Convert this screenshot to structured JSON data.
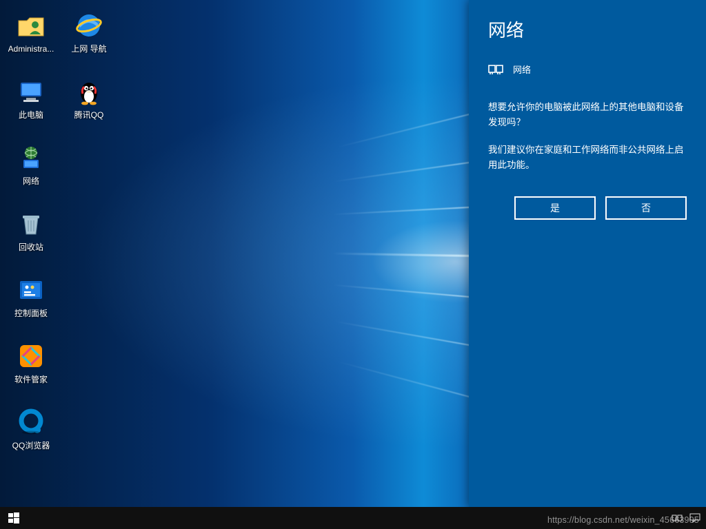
{
  "desktop": {
    "icons": [
      {
        "id": "user-folder",
        "label": "Administra...",
        "kind": "user-folder"
      },
      {
        "id": "ie",
        "label": "上网 导航",
        "kind": "ie"
      },
      {
        "id": "this-pc",
        "label": "此电脑",
        "kind": "pc"
      },
      {
        "id": "qq",
        "label": "腾讯QQ",
        "kind": "qq"
      },
      {
        "id": "network",
        "label": "网络",
        "kind": "network"
      },
      {
        "id": "blank1",
        "label": "",
        "kind": "none"
      },
      {
        "id": "recycle-bin",
        "label": "回收站",
        "kind": "recycle"
      },
      {
        "id": "blank2",
        "label": "",
        "kind": "none"
      },
      {
        "id": "control-panel",
        "label": "控制面板",
        "kind": "control"
      },
      {
        "id": "blank3",
        "label": "",
        "kind": "none"
      },
      {
        "id": "soft-manager",
        "label": "软件管家",
        "kind": "softmgr"
      },
      {
        "id": "blank4",
        "label": "",
        "kind": "none"
      },
      {
        "id": "qq-browser",
        "label": "QQ浏览器",
        "kind": "qqbrowser"
      }
    ]
  },
  "flyout": {
    "title": "网络",
    "network_name": "网络",
    "message1": "想要允许你的电脑被此网络上的其他电脑和设备发现吗？",
    "message2": "我们建议你在家庭和工作网络而非公共网络上启用此功能。",
    "yes": "是",
    "no": "否"
  },
  "taskbar": {
    "start_tooltip": "Start"
  },
  "watermark": "https://blog.csdn.net/weixin_45663905",
  "colors": {
    "flyout_bg": "#005a9e",
    "taskbar_bg": "#101010"
  }
}
